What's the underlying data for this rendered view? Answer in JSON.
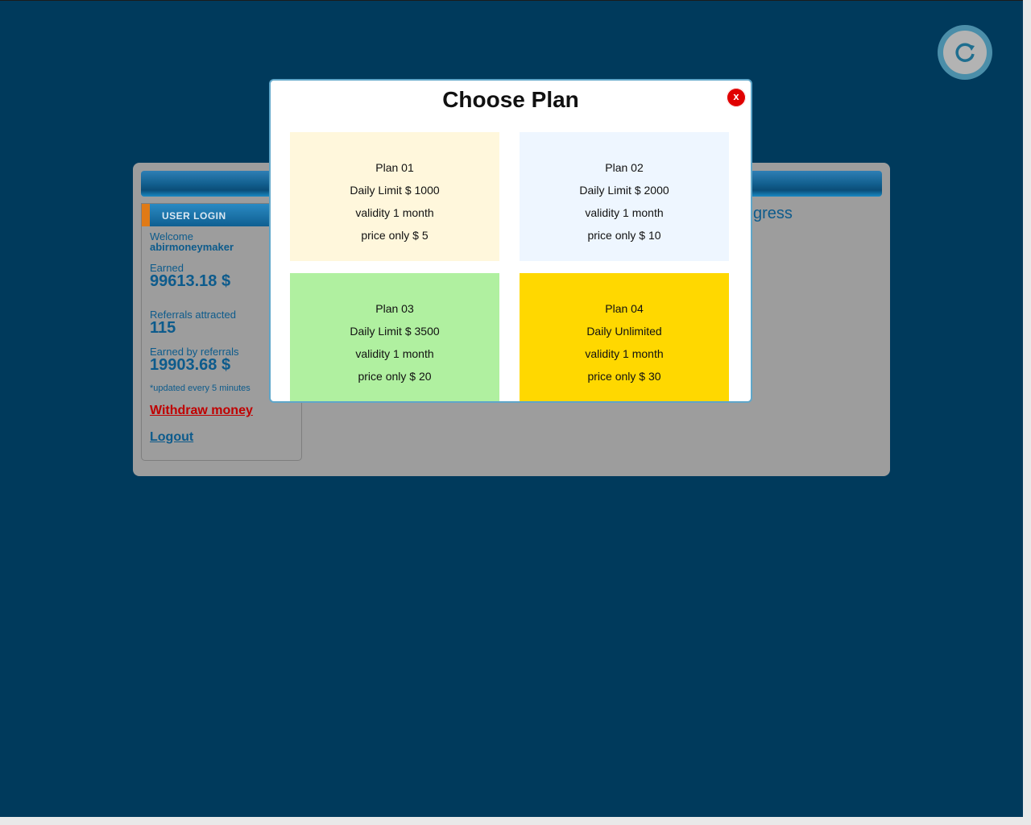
{
  "colors": {
    "page_bg": "#003a5c",
    "panel_bg": "#9d9d9d",
    "accent_blue": "#0d5b8c",
    "link_red": "#c00000",
    "close_red": "#e00000",
    "plan_colors": [
      "#fff7dc",
      "#eef6ff",
      "#b0f0a0",
      "#ffd800"
    ]
  },
  "refresh": {
    "icon": "refresh-icon"
  },
  "background_page": {
    "progress_text": "gress"
  },
  "sidebar": {
    "header": "USER LOGIN",
    "welcome_label": "Welcome",
    "username": "abirmoneymaker",
    "earned_label": "Earned",
    "earned_value": "99613.18 $",
    "referrals_label": "Referrals attracted",
    "referrals_value": "115",
    "earned_ref_label": "Earned by referrals",
    "earned_ref_value": "19903.68 $",
    "update_note": "*updated every 5 minutes",
    "withdraw_link": "Withdraw money",
    "logout_link": "Logout"
  },
  "modal": {
    "title": "Choose Plan",
    "close_label": "x",
    "plans": [
      {
        "name": "Plan 01",
        "limit": "Daily Limit $ 1000",
        "validity": "validity 1 month",
        "price": "price only $ 5"
      },
      {
        "name": "Plan 02",
        "limit": "Daily Limit $ 2000",
        "validity": "validity 1 month",
        "price": "price only $ 10"
      },
      {
        "name": "Plan 03",
        "limit": "Daily Limit $ 3500",
        "validity": "validity 1 month",
        "price": "price only $ 20"
      },
      {
        "name": "Plan 04",
        "limit": "Daily Unlimited",
        "validity": "validity 1 month",
        "price": "price only $ 30"
      }
    ]
  }
}
